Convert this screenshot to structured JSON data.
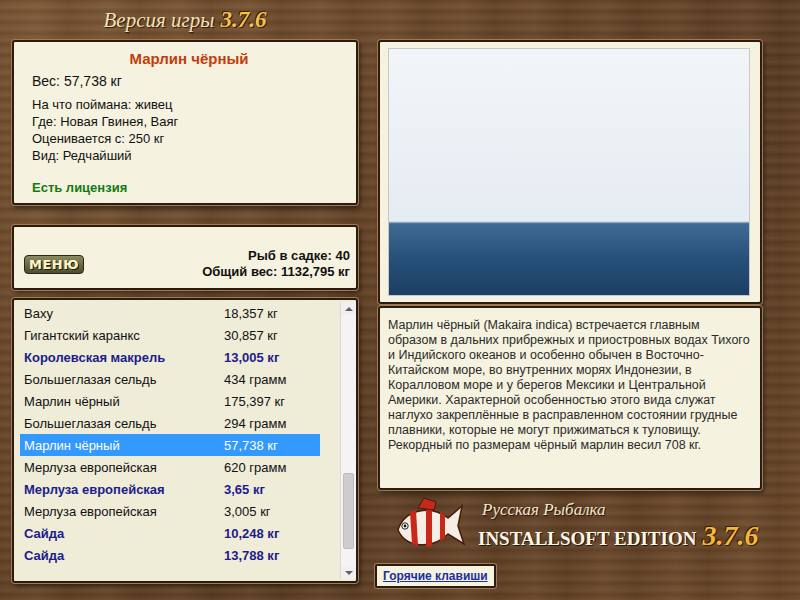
{
  "header": {
    "title": "Версия игры",
    "version": "3.7.6"
  },
  "fish_card": {
    "name": "Марлин чёрный",
    "weight": "Вес: 57,738 кг",
    "details": [
      "На что поймана: живец",
      "Где: Новая Гвинея, Ваяг",
      "Оценивается с: 250 кг",
      "Вид: Редчайший"
    ],
    "license": "Есть лицензия"
  },
  "cage": {
    "menu_button": "МЕНЮ",
    "count": "Рыб в садке: 40",
    "total": "Общий вес: 1132,795 кг"
  },
  "catch_list": {
    "rows": [
      {
        "name": "Ваху",
        "weight": "18,357 кг",
        "trophy": false,
        "selected": false
      },
      {
        "name": "Гигантский каранкс",
        "weight": "30,857 кг",
        "trophy": false,
        "selected": false
      },
      {
        "name": "Королевская макрель",
        "weight": "13,005 кг",
        "trophy": true,
        "selected": false
      },
      {
        "name": "Большеглазая сельдь",
        "weight": "434 грамм",
        "trophy": false,
        "selected": false
      },
      {
        "name": "Марлин чёрный",
        "weight": "175,397 кг",
        "trophy": false,
        "selected": false
      },
      {
        "name": "Большеглазая сельдь",
        "weight": "294 грамм",
        "trophy": false,
        "selected": false
      },
      {
        "name": "Марлин чёрный",
        "weight": "57,738 кг",
        "trophy": false,
        "selected": true
      },
      {
        "name": "Мерлуза европейская",
        "weight": "620 грамм",
        "trophy": false,
        "selected": false
      },
      {
        "name": "Мерлуза европейская",
        "weight": "3,65 кг",
        "trophy": true,
        "selected": false
      },
      {
        "name": "Мерлуза европейская",
        "weight": "3,005 кг",
        "trophy": false,
        "selected": false
      },
      {
        "name": "Сайда",
        "weight": "10,248 кг",
        "trophy": true,
        "selected": false
      },
      {
        "name": "Сайда",
        "weight": "13,788 кг",
        "trophy": true,
        "selected": false
      }
    ],
    "scrollbar": {
      "level": 0.9
    }
  },
  "description": "Марлин чёрный (Makaira indica) встречается главным образом в дальних прибрежных и приостровных водах Тихого и Индийского океанов и особенно обычен в Восточно-Китайском море, во внутренних морях Индонезии, в Коралловом море и у берегов Мексики и Центральной Америки. Характерной особенностью этого вида служат наглухо закреплённые в расправленном состоянии грудные плавники, которые не могут прижиматься к туловищу. Рекордный по размерам чёрный марлин весил 708 кг.",
  "brand": {
    "line1": "Русская Рыбалка",
    "line2": "INSTALLSOFT EDITION",
    "version": "3.7.6"
  },
  "buttons": {
    "hotkeys": "Горячие клавиши"
  }
}
